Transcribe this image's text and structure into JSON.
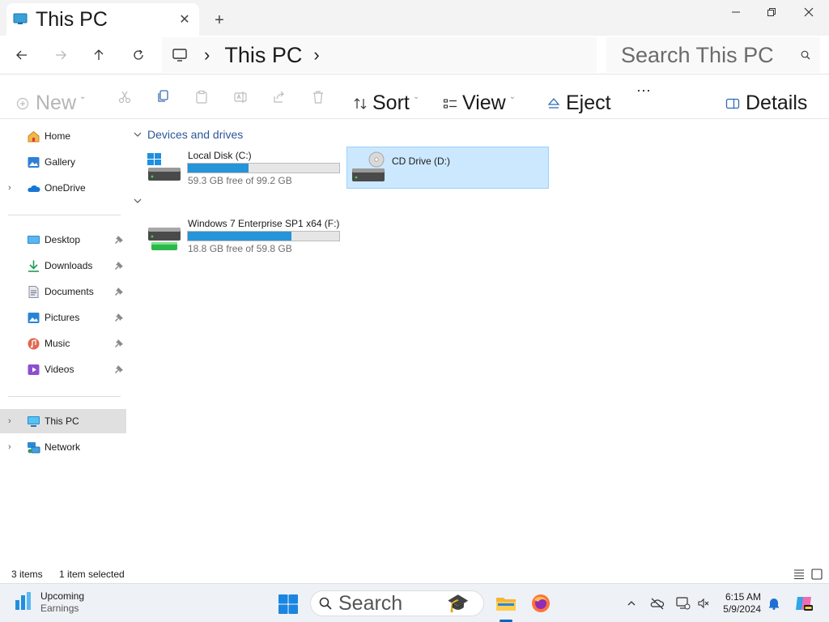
{
  "window": {
    "tab_title": "This PC",
    "tab_close_label": "✕",
    "new_tab_label": "+"
  },
  "address": {
    "chevron": "›",
    "crumb": "This PC",
    "search_placeholder": "Search This PC"
  },
  "commands": {
    "new": "New",
    "sort": "Sort",
    "view": "View",
    "eject": "Eject",
    "more": "···",
    "details": "Details"
  },
  "sidebar": {
    "quick": [
      {
        "label": "Home",
        "icon": "home-icon"
      },
      {
        "label": "Gallery",
        "icon": "gallery-icon"
      },
      {
        "label": "OneDrive",
        "icon": "onedrive-icon"
      }
    ],
    "pinned": [
      {
        "label": "Desktop",
        "icon": "desktop-icon"
      },
      {
        "label": "Downloads",
        "icon": "downloads-icon"
      },
      {
        "label": "Documents",
        "icon": "documents-icon"
      },
      {
        "label": "Pictures",
        "icon": "pictures-icon"
      },
      {
        "label": "Music",
        "icon": "music-icon"
      },
      {
        "label": "Videos",
        "icon": "videos-icon"
      }
    ],
    "devices": [
      {
        "label": "This PC",
        "icon": "this-pc-icon",
        "selected": true
      },
      {
        "label": "Network",
        "icon": "network-icon"
      }
    ]
  },
  "content": {
    "group_title": "Devices and drives",
    "drives": [
      {
        "name": "Local Disk (C:)",
        "free_text": "59.3 GB free of 99.2 GB",
        "used_fraction": 0.402
      },
      {
        "name": "CD Drive (D:)",
        "selected": true
      },
      {
        "name": "Windows 7 Enterprise SP1 x64 (F:)",
        "free_text": "18.8 GB free of 59.8 GB",
        "used_fraction": 0.686
      }
    ]
  },
  "status": {
    "items": "3 items",
    "selected": "1 item selected"
  },
  "taskbar": {
    "widget_title": "Upcoming",
    "widget_sub": "Earnings",
    "search": "Search",
    "time": "6:15 AM",
    "date": "5/9/2024"
  },
  "colors": {
    "accent": "#0067c0",
    "drive_bar": "#2694d9",
    "selection": "#cce8ff",
    "group_header": "#2b5797"
  }
}
